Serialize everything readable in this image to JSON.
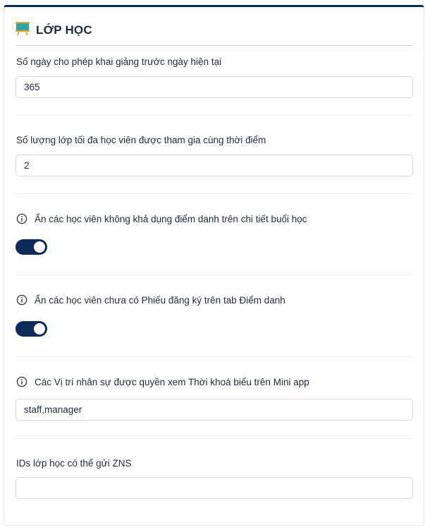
{
  "section": {
    "title": "LỚP HỌC",
    "icon": "classroom-board-icon"
  },
  "fields": {
    "days_before": {
      "label": "Số ngày cho phép khai giảng trước ngày hiện tại",
      "value": "365"
    },
    "max_classes": {
      "label": "Số lượng lớp tối đa học viên được tham gia cùng thời điểm",
      "value": "2"
    },
    "hide_unavailable": {
      "label": "Ẩn các học viên không khả dụng điểm danh trên chi tiết buổi học",
      "enabled": true
    },
    "hide_no_form": {
      "label": "Ẩn các học viên chưa có Phiếu đăng ký trên tab Điểm danh",
      "enabled": true
    },
    "staff_positions": {
      "label": "Các Vị trí nhân sự được quyền xem Thời khoá biểu trên Mini app",
      "value": "staff,manager"
    },
    "zns_class_ids": {
      "label": "IDs lớp học có thể gửi ZNS",
      "value": ""
    }
  },
  "colors": {
    "accent": "#0b2a5c",
    "border": "#d6dade"
  }
}
